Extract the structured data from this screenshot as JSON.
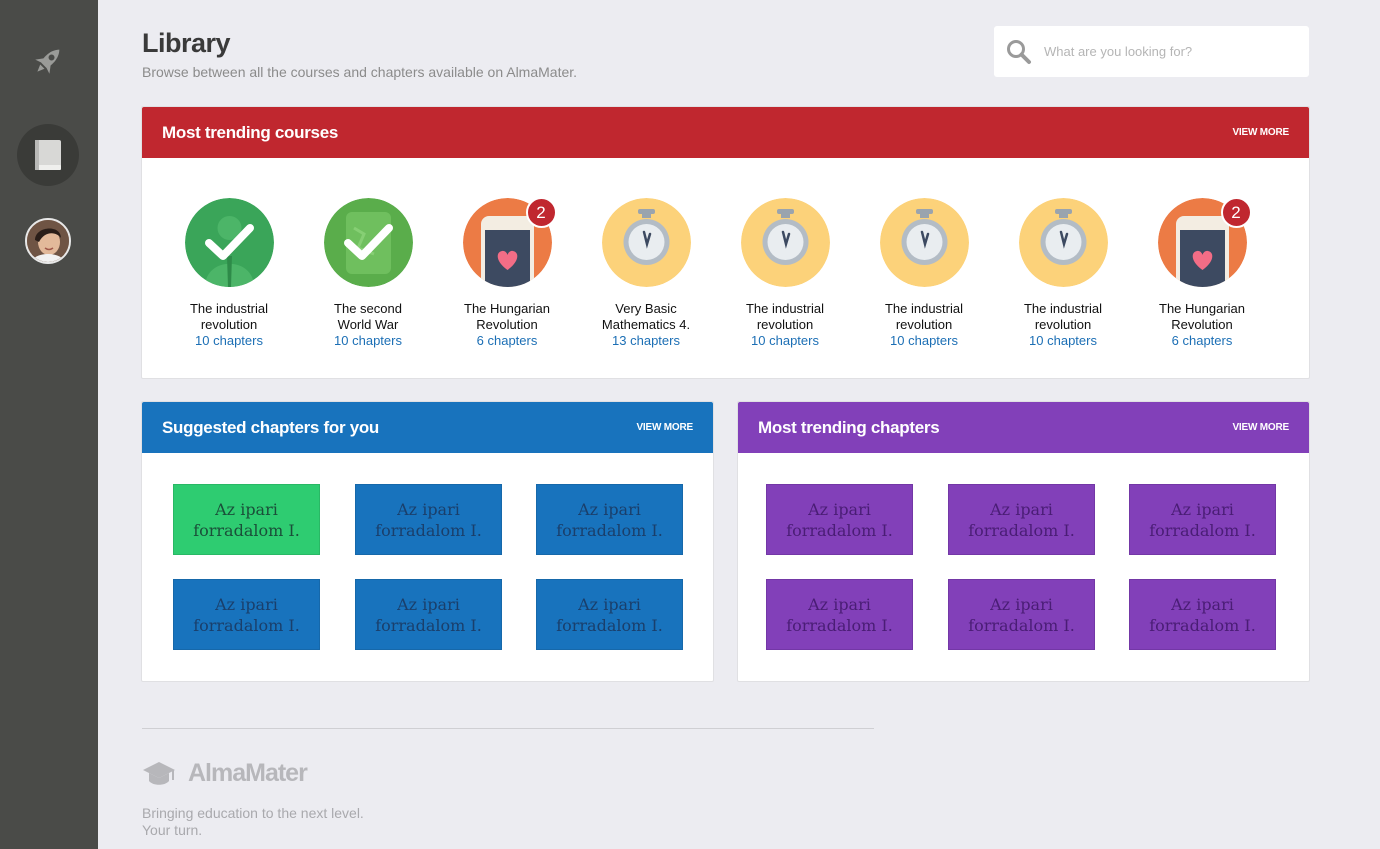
{
  "header": {
    "title": "Library",
    "subtitle": "Browse between all the courses and chapters available on AlmaMater."
  },
  "search": {
    "placeholder": "What are you looking for?"
  },
  "trending_courses": {
    "title": "Most trending courses",
    "view_more": "VIEW MORE",
    "items": [
      {
        "title_line1": "The industrial",
        "title_line2": "revolution",
        "chapters": "10 chapters",
        "icon": "completed-check-icon",
        "badge": ""
      },
      {
        "title_line1": "The second",
        "title_line2": "World War",
        "chapters": "10 chapters",
        "icon": "completed-check-icon",
        "badge": ""
      },
      {
        "title_line1": "The Hungarian",
        "title_line2": "Revolution",
        "chapters": "6 chapters",
        "icon": "phone-heart-icon",
        "badge": "2"
      },
      {
        "title_line1": "Very Basic",
        "title_line2": "Mathematics 4.",
        "chapters": "13 chapters",
        "icon": "stopwatch-icon",
        "badge": ""
      },
      {
        "title_line1": "The industrial",
        "title_line2": "revolution",
        "chapters": "10 chapters",
        "icon": "stopwatch-icon",
        "badge": ""
      },
      {
        "title_line1": "The industrial",
        "title_line2": "revolution",
        "chapters": "10 chapters",
        "icon": "stopwatch-icon",
        "badge": ""
      },
      {
        "title_line1": "The industrial",
        "title_line2": "revolution",
        "chapters": "10 chapters",
        "icon": "stopwatch-icon",
        "badge": ""
      },
      {
        "title_line1": "The Hungarian",
        "title_line2": "Revolution",
        "chapters": "6 chapters",
        "icon": "phone-heart-icon",
        "badge": "2"
      }
    ]
  },
  "suggested_chapters": {
    "title": "Suggested chapters for you",
    "view_more": "VIEW MORE",
    "tiles": [
      {
        "line1": "Az ipari",
        "line2": "forradalom I.",
        "color": "green"
      },
      {
        "line1": "Az ipari",
        "line2": "forradalom I.",
        "color": "blue"
      },
      {
        "line1": "Az ipari",
        "line2": "forradalom I.",
        "color": "blue"
      },
      {
        "line1": "Az ipari",
        "line2": "forradalom I.",
        "color": "blue"
      },
      {
        "line1": "Az ipari",
        "line2": "forradalom I.",
        "color": "blue"
      },
      {
        "line1": "Az ipari",
        "line2": "forradalom I.",
        "color": "blue"
      }
    ]
  },
  "trending_chapters": {
    "title": "Most trending chapters",
    "view_more": "VIEW MORE",
    "tiles": [
      {
        "line1": "Az ipari",
        "line2": "forradalom I.",
        "color": "purple"
      },
      {
        "line1": "Az ipari",
        "line2": "forradalom I.",
        "color": "purple"
      },
      {
        "line1": "Az ipari",
        "line2": "forradalom I.",
        "color": "purple"
      },
      {
        "line1": "Az ipari",
        "line2": "forradalom I.",
        "color": "purple"
      },
      {
        "line1": "Az ipari",
        "line2": "forradalom I.",
        "color": "purple"
      },
      {
        "line1": "Az ipari",
        "line2": "forradalom I.",
        "color": "purple"
      }
    ]
  },
  "footer": {
    "brand": "AlmaMater",
    "tagline_line1": "Bringing education to the next level.",
    "tagline_line2": "Your turn."
  },
  "sidebar": {
    "items": [
      {
        "icon": "rocket-icon"
      },
      {
        "icon": "book-icon",
        "active": true
      },
      {
        "icon": "user-avatar"
      }
    ]
  },
  "colors": {
    "sidebar": "#4a4b48",
    "courses_header": "#c0272f",
    "suggested_header": "#1873bd",
    "trending_header": "#8240b9",
    "tile_green": "#2ecc71",
    "link": "#1c6fb5"
  }
}
